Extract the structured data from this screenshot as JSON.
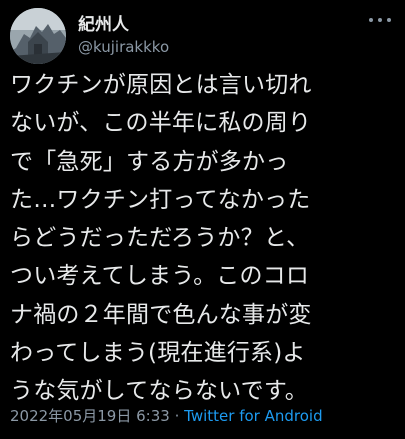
{
  "author": {
    "display_name": "紀州人",
    "handle": "@kujirakkko"
  },
  "tweet": {
    "lines": [
      "ワクチンが原因とは言い切れ",
      "ないが、この半年に私の周り",
      "で「急死」する方が多かっ",
      "た…ワクチン打ってなかった",
      "らどうだっただろうか？と、",
      "つい考えてしまう。このコロ",
      "ナ禍の２年間で色んな事が変",
      "わってしまう(現在進行系)よ",
      "うな気がしてならないです。"
    ]
  },
  "meta": {
    "timestamp": "2022年05月19日 6:33",
    "separator": "·",
    "source": "Twitter for Android"
  },
  "icons": {
    "more": "more-icon",
    "avatar": "avatar"
  },
  "colors": {
    "background": "#000000",
    "text": "#e7e9ea",
    "secondary": "#8b98a5",
    "link": "#1d9bf0"
  }
}
